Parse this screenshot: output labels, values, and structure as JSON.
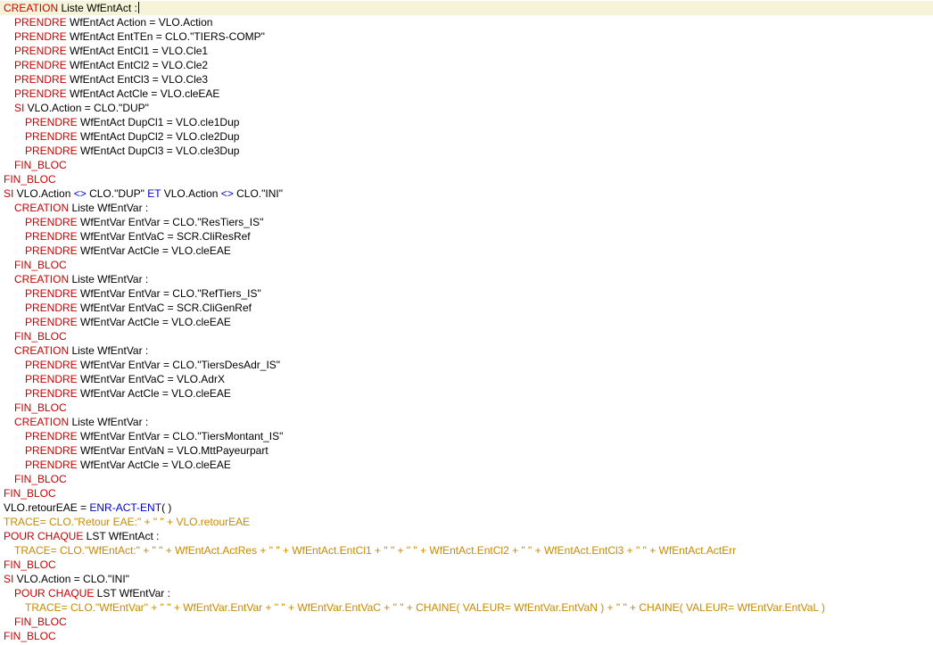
{
  "editor": {
    "colors": {
      "keyword": "#cc0000",
      "operator": "#0000cc",
      "trace": "#c88a00",
      "text": "#000000",
      "current_line": "#f6f4d8"
    },
    "lines": [
      {
        "indent": 0,
        "tokens": [
          [
            "k",
            "CREATION"
          ],
          [
            "t",
            " Liste WfEntAct :"
          ]
        ],
        "current": true
      },
      {
        "indent": 1,
        "tokens": [
          [
            "k",
            "PRENDRE"
          ],
          [
            "t",
            " WfEntAct Action = VLO.Action"
          ]
        ]
      },
      {
        "indent": 1,
        "tokens": [
          [
            "k",
            "PRENDRE"
          ],
          [
            "t",
            " WfEntAct EntTEn = CLO.\"TIERS-COMP\""
          ]
        ]
      },
      {
        "indent": 1,
        "tokens": [
          [
            "k",
            "PRENDRE"
          ],
          [
            "t",
            " WfEntAct EntCl1 = VLO.Cle1"
          ]
        ]
      },
      {
        "indent": 1,
        "tokens": [
          [
            "k",
            "PRENDRE"
          ],
          [
            "t",
            " WfEntAct EntCl2 = VLO.Cle2"
          ]
        ]
      },
      {
        "indent": 1,
        "tokens": [
          [
            "k",
            "PRENDRE"
          ],
          [
            "t",
            " WfEntAct EntCl3 = VLO.Cle3"
          ]
        ]
      },
      {
        "indent": 1,
        "tokens": [
          [
            "k",
            "PRENDRE"
          ],
          [
            "t",
            " WfEntAct ActCle = VLO.cleEAE"
          ]
        ]
      },
      {
        "indent": 1,
        "tokens": [
          [
            "k",
            "SI"
          ],
          [
            "t",
            " VLO.Action = CLO.\"DUP\""
          ]
        ]
      },
      {
        "indent": 2,
        "tokens": [
          [
            "k",
            "PRENDRE"
          ],
          [
            "t",
            " WfEntAct DupCl1 = VLO.cle1Dup"
          ]
        ]
      },
      {
        "indent": 2,
        "tokens": [
          [
            "k",
            "PRENDRE"
          ],
          [
            "t",
            " WfEntAct DupCl2 = VLO.cle2Dup"
          ]
        ]
      },
      {
        "indent": 2,
        "tokens": [
          [
            "k",
            "PRENDRE"
          ],
          [
            "t",
            " WfEntAct DupCl3 = VLO.cle3Dup"
          ]
        ]
      },
      {
        "indent": 1,
        "tokens": [
          [
            "k",
            "FIN_BLOC"
          ]
        ]
      },
      {
        "indent": 0,
        "tokens": [
          [
            "k",
            "FIN_BLOC"
          ]
        ]
      },
      {
        "indent": 0,
        "tokens": [
          [
            "k",
            "SI"
          ],
          [
            "t",
            " VLO.Action "
          ],
          [
            "o",
            "<>"
          ],
          [
            "t",
            " CLO.\"DUP\" "
          ],
          [
            "o",
            "ET"
          ],
          [
            "t",
            " VLO.Action "
          ],
          [
            "o",
            "<>"
          ],
          [
            "t",
            " CLO.\"INI\""
          ]
        ]
      },
      {
        "indent": 1,
        "tokens": [
          [
            "k",
            "CREATION"
          ],
          [
            "t",
            " Liste WfEntVar :"
          ]
        ]
      },
      {
        "indent": 2,
        "tokens": [
          [
            "k",
            "PRENDRE"
          ],
          [
            "t",
            " WfEntVar EntVar = CLO.\"ResTiers_IS\""
          ]
        ]
      },
      {
        "indent": 2,
        "tokens": [
          [
            "k",
            "PRENDRE"
          ],
          [
            "t",
            " WfEntVar EntVaC = SCR.CliResRef"
          ]
        ]
      },
      {
        "indent": 2,
        "tokens": [
          [
            "k",
            "PRENDRE"
          ],
          [
            "t",
            " WfEntVar ActCle = VLO.cleEAE"
          ]
        ]
      },
      {
        "indent": 1,
        "tokens": [
          [
            "k",
            "FIN_BLOC"
          ]
        ]
      },
      {
        "indent": 1,
        "tokens": [
          [
            "k",
            "CREATION"
          ],
          [
            "t",
            " Liste WfEntVar :"
          ]
        ]
      },
      {
        "indent": 2,
        "tokens": [
          [
            "k",
            "PRENDRE"
          ],
          [
            "t",
            " WfEntVar EntVar = CLO.\"RefTiers_IS\""
          ]
        ]
      },
      {
        "indent": 2,
        "tokens": [
          [
            "k",
            "PRENDRE"
          ],
          [
            "t",
            " WfEntVar EntVaC = SCR.CliGenRef"
          ]
        ]
      },
      {
        "indent": 2,
        "tokens": [
          [
            "k",
            "PRENDRE"
          ],
          [
            "t",
            " WfEntVar ActCle = VLO.cleEAE"
          ]
        ]
      },
      {
        "indent": 1,
        "tokens": [
          [
            "k",
            "FIN_BLOC"
          ]
        ]
      },
      {
        "indent": 1,
        "tokens": [
          [
            "k",
            "CREATION"
          ],
          [
            "t",
            " Liste WfEntVar :"
          ]
        ]
      },
      {
        "indent": 2,
        "tokens": [
          [
            "k",
            "PRENDRE"
          ],
          [
            "t",
            " WfEntVar EntVar = CLO.\"TiersDesAdr_IS\""
          ]
        ]
      },
      {
        "indent": 2,
        "tokens": [
          [
            "k",
            "PRENDRE"
          ],
          [
            "t",
            " WfEntVar EntVaC = VLO.AdrX"
          ]
        ]
      },
      {
        "indent": 2,
        "tokens": [
          [
            "k",
            "PRENDRE"
          ],
          [
            "t",
            " WfEntVar ActCle = VLO.cleEAE"
          ]
        ]
      },
      {
        "indent": 1,
        "tokens": [
          [
            "k",
            "FIN_BLOC"
          ]
        ]
      },
      {
        "indent": 1,
        "tokens": [
          [
            "k",
            "CREATION"
          ],
          [
            "t",
            " Liste WfEntVar :"
          ]
        ]
      },
      {
        "indent": 2,
        "tokens": [
          [
            "k",
            "PRENDRE"
          ],
          [
            "t",
            " WfEntVar EntVar = CLO.\"TiersMontant_IS\""
          ]
        ]
      },
      {
        "indent": 2,
        "tokens": [
          [
            "k",
            "PRENDRE"
          ],
          [
            "t",
            " WfEntVar EntVaN = VLO.MttPayeurpart"
          ]
        ]
      },
      {
        "indent": 2,
        "tokens": [
          [
            "k",
            "PRENDRE"
          ],
          [
            "t",
            " WfEntVar ActCle = VLO.cleEAE"
          ]
        ]
      },
      {
        "indent": 1,
        "tokens": [
          [
            "k",
            "FIN_BLOC"
          ]
        ]
      },
      {
        "indent": 0,
        "tokens": [
          [
            "k",
            "FIN_BLOC"
          ]
        ]
      },
      {
        "indent": 0,
        "tokens": [
          [
            "t",
            "VLO.retourEAE = "
          ],
          [
            "o",
            "ENR-ACT-ENT"
          ],
          [
            "t",
            "( )"
          ]
        ]
      },
      {
        "indent": 0,
        "tokens": [
          [
            "r",
            "TRACE= CLO.\"Retour EAE:\" + \" \" + VLO.retourEAE"
          ]
        ]
      },
      {
        "indent": 0,
        "tokens": [
          [
            "k",
            "POUR CHAQUE"
          ],
          [
            "t",
            " LST WfEntAct :"
          ]
        ]
      },
      {
        "indent": 1,
        "tokens": [
          [
            "r",
            "TRACE= CLO.\"WfEntAct:\" + \" \" + WfEntAct.ActRes + \" \" + WfEntAct.EntCl1 + \" \" + \" \" + WfEntAct.EntCl2 + \" \" + WfEntAct.EntCl3 + \" \" + WfEntAct.ActErr"
          ]
        ]
      },
      {
        "indent": 0,
        "tokens": [
          [
            "k",
            "FIN_BLOC"
          ]
        ]
      },
      {
        "indent": 0,
        "tokens": [
          [
            "k",
            "SI"
          ],
          [
            "t",
            " VLO.Action = CLO.\"INI\""
          ]
        ]
      },
      {
        "indent": 1,
        "tokens": [
          [
            "k",
            "POUR CHAQUE"
          ],
          [
            "t",
            " LST WfEntVar :"
          ]
        ]
      },
      {
        "indent": 2,
        "tokens": [
          [
            "r",
            "TRACE= CLO.\"WfEntVar\" + \" \" + WfEntVar.EntVar + \" \" + WfEntVar.EntVaC + \" \" + CHAINE( VALEUR= WfEntVar.EntVaN ) + \" \" + CHAINE( VALEUR= WfEntVar.EntVaL )"
          ]
        ]
      },
      {
        "indent": 1,
        "tokens": [
          [
            "k",
            "FIN_BLOC"
          ]
        ]
      },
      {
        "indent": 0,
        "tokens": [
          [
            "k",
            "FIN_BLOC"
          ]
        ]
      }
    ]
  }
}
